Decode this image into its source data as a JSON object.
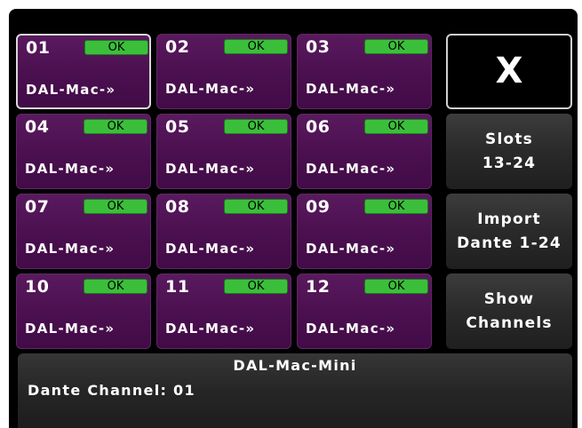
{
  "slots": [
    {
      "num": "01",
      "status": "OK",
      "name": "DAL-Mac-»"
    },
    {
      "num": "02",
      "status": "OK",
      "name": "DAL-Mac-»"
    },
    {
      "num": "03",
      "status": "OK",
      "name": "DAL-Mac-»"
    },
    {
      "num": "04",
      "status": "OK",
      "name": "DAL-Mac-»"
    },
    {
      "num": "05",
      "status": "OK",
      "name": "DAL-Mac-»"
    },
    {
      "num": "06",
      "status": "OK",
      "name": "DAL-Mac-»"
    },
    {
      "num": "07",
      "status": "OK",
      "name": "DAL-Mac-»"
    },
    {
      "num": "08",
      "status": "OK",
      "name": "DAL-Mac-»"
    },
    {
      "num": "09",
      "status": "OK",
      "name": "DAL-Mac-»"
    },
    {
      "num": "10",
      "status": "OK",
      "name": "DAL-Mac-»"
    },
    {
      "num": "11",
      "status": "OK",
      "name": "DAL-Mac-»"
    },
    {
      "num": "12",
      "status": "OK",
      "name": "DAL-Mac-»"
    }
  ],
  "side_buttons": {
    "close": "X",
    "slots": "Slots\n13-24",
    "import": "Import\nDante 1-24",
    "show_channels": "Show\nChannels"
  },
  "info": {
    "title": "DAL-Mac-Mini",
    "channel": "Dante Channel: 01"
  },
  "colors": {
    "slot_bg": "#4a0f4f",
    "ok_badge": "#3bbf3b",
    "button_bg": "#2a2a2a",
    "screen_bg": "#000000"
  }
}
